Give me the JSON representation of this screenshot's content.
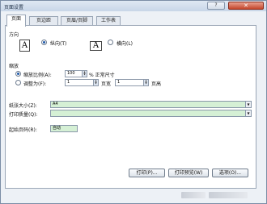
{
  "window": {
    "title": "页面设置",
    "help_label": "?",
    "close_label": "✕"
  },
  "tabs": [
    {
      "label": "页面"
    },
    {
      "label": "页边距"
    },
    {
      "label": "页眉/页脚"
    },
    {
      "label": "工作表"
    }
  ],
  "orientation": {
    "section_label": "方向",
    "portrait_label": "纵向(T)",
    "landscape_label": "横向(L)",
    "selected": "portrait",
    "icon_glyph": "A"
  },
  "scaling": {
    "section_label": "缩放",
    "adjust_label": "缩放比例(A):",
    "adjust_value": "100",
    "adjust_suffix": "% 正常尺寸",
    "fit_label": "调整为(F):",
    "fit_wide_value": "1",
    "fit_wide_label": "页宽",
    "fit_tall_value": "1",
    "fit_tall_label": "页高",
    "selected": "adjust"
  },
  "paper_size": {
    "label": "纸张大小(Z):",
    "value": "A4"
  },
  "print_quality": {
    "label": "打印质量(Q):",
    "value": ""
  },
  "first_page": {
    "label": "起始页码(R):",
    "value": "自动"
  },
  "buttons": {
    "print": "打印(P)...",
    "preview": "打印预览(W)",
    "options": "选项(O)..."
  }
}
